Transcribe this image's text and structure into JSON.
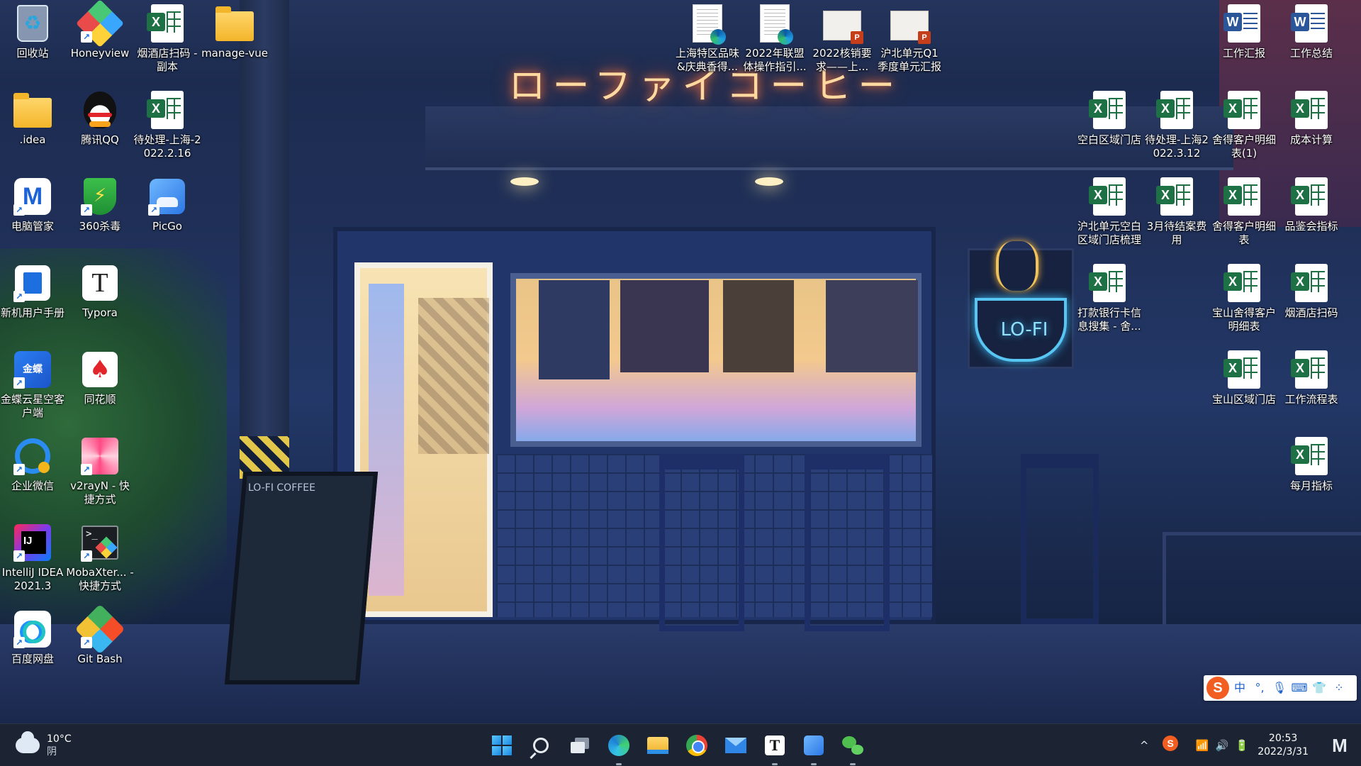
{
  "desktop": {
    "icons": [
      {
        "label": "回收站"
      },
      {
        "label": "Honeyview"
      },
      {
        "label": "烟酒店扫码 - 副本"
      },
      {
        "label": "manage-vue"
      },
      {
        "label": ".idea"
      },
      {
        "label": "腾讯QQ"
      },
      {
        "label": "待处理-上海-2022.2.16"
      },
      {
        "label": "电脑管家"
      },
      {
        "label": "360杀毒"
      },
      {
        "label": "PicGo"
      },
      {
        "label": "新机用户手册"
      },
      {
        "label": "Typora"
      },
      {
        "label": "金蝶云星空客户端"
      },
      {
        "label": "同花顺"
      },
      {
        "label": "企业微信"
      },
      {
        "label": "v2rayN - 快捷方式"
      },
      {
        "label": "IntelliJ IDEA 2021.3"
      },
      {
        "label": "MobaXter... - 快捷方式"
      },
      {
        "label": "百度网盘"
      },
      {
        "label": "Git Bash"
      },
      {
        "label": "上海特区品味&庆典香得..."
      },
      {
        "label": "2022年联盟体操作指引..."
      },
      {
        "label": "2022核销要求——上..."
      },
      {
        "label": "沪北单元Q1季度单元汇报"
      },
      {
        "label": "工作汇报"
      },
      {
        "label": "工作总结"
      },
      {
        "label": "空白区域门店"
      },
      {
        "label": "待处理-上海2022.3.12"
      },
      {
        "label": "舍得客户明细表(1)"
      },
      {
        "label": "成本计算"
      },
      {
        "label": "沪北单元空白区域门店梳理"
      },
      {
        "label": "3月待结案费用"
      },
      {
        "label": "舍得客户明细表"
      },
      {
        "label": "品鉴会指标"
      },
      {
        "label": "打款银行卡信息搜集 - 舍..."
      },
      {
        "label": "宝山舍得客户明细表"
      },
      {
        "label": "烟酒店扫码"
      },
      {
        "label": "宝山区域门店"
      },
      {
        "label": "工作流程表"
      },
      {
        "label": "每月指标"
      }
    ]
  },
  "wallpaper": {
    "neon_sign": "ローファイコーヒー",
    "cup_sign": "LO-FI",
    "board_sign": "LO-FI COFFEE"
  },
  "ime": {
    "logo": "S",
    "mode": "中",
    "punct": "°,",
    "mic": "🎙",
    "keyboard": "⌨",
    "skin": "👕",
    "tools": "⁘"
  },
  "taskbar": {
    "weather": {
      "temp": "10°C",
      "condition": "阴"
    },
    "apps": [
      {
        "name": "start"
      },
      {
        "name": "search"
      },
      {
        "name": "task-view"
      },
      {
        "name": "edge"
      },
      {
        "name": "file-explorer"
      },
      {
        "name": "chrome"
      },
      {
        "name": "mail"
      },
      {
        "name": "typora"
      },
      {
        "name": "picgo"
      },
      {
        "name": "wechat"
      }
    ],
    "typora_letter": "T",
    "tray": {
      "chevron": "^",
      "sogou": "S",
      "wifi": "📶",
      "volume": "🔊",
      "battery": "🔋"
    },
    "clock": {
      "time": "20:53",
      "date": "2022/3/31"
    },
    "corner_logo": "M"
  },
  "colors": {
    "taskbar_bg": "#1c2433",
    "excel_green": "#1e7145",
    "word_blue": "#2b579a",
    "sogou_orange": "#f25d22"
  }
}
